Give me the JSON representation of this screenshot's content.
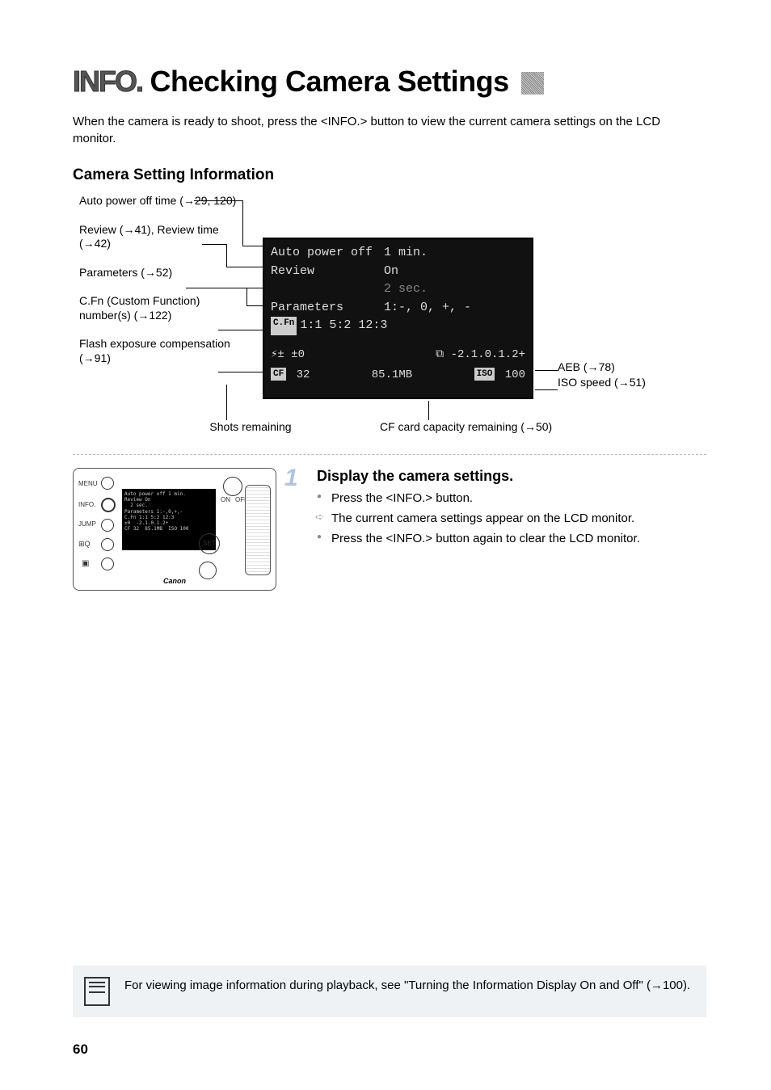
{
  "title_prefix": "INFO.",
  "title_main": "Checking Camera Settings",
  "intro": "When the camera is ready to shoot, press the <INFO.> button to view the current camera settings on the LCD monitor.",
  "section_heading": "Camera Setting Information",
  "left_labels": {
    "auto_power_off": "Auto power off time (→29, 120)",
    "review": "Review (→41), Review time (→42)",
    "parameters": "Parameters (→52)",
    "cfn": "C.Fn (Custom Function) number(s) (→122)",
    "flash": "Flash exposure compensation (→91)"
  },
  "screen": {
    "auto_power_off_label": "Auto power off",
    "auto_power_off_value": "1 min.",
    "review_label": "Review",
    "review_value": "On",
    "review_time_value": "2 sec.",
    "parameters_label": "Parameters",
    "parameters_value": "1:-, 0, +, -",
    "cfn_label": "C.Fn",
    "cfn_value": "1:1 5:2 12:3",
    "flash_icon": "⚡±",
    "flash_value": "±0",
    "aeb_icon": "⧉",
    "aeb_value": "-2.1.0.1.2+",
    "cf_icon": "CF",
    "shots_remaining": "32",
    "capacity": "85.1MB",
    "iso_icon": "ISO",
    "iso_value": "100"
  },
  "right_labels": {
    "aeb": "AEB (→78)",
    "iso": "ISO speed (→51)"
  },
  "bottom_labels": {
    "shots": "Shots remaining",
    "capacity": "CF card capacity remaining  (→50)"
  },
  "step": {
    "number": "1",
    "title": "Display the camera settings.",
    "items": [
      {
        "type": "dot",
        "text": "Press the <INFO.> button."
      },
      {
        "type": "arrow",
        "text": "The current camera settings appear on the LCD monitor."
      },
      {
        "type": "dot",
        "text": "Press the <INFO.> button again to clear the LCD monitor."
      }
    ]
  },
  "camera_buttons": {
    "menu": "MENU",
    "info": "INFO.",
    "jump": "JUMP",
    "set": "SET",
    "on": "ON",
    "off": "OFF",
    "logo": "Canon"
  },
  "note": "For viewing image information during playback, see \"Turning the Information Display On and Off\" (→100).",
  "page_number": "60"
}
